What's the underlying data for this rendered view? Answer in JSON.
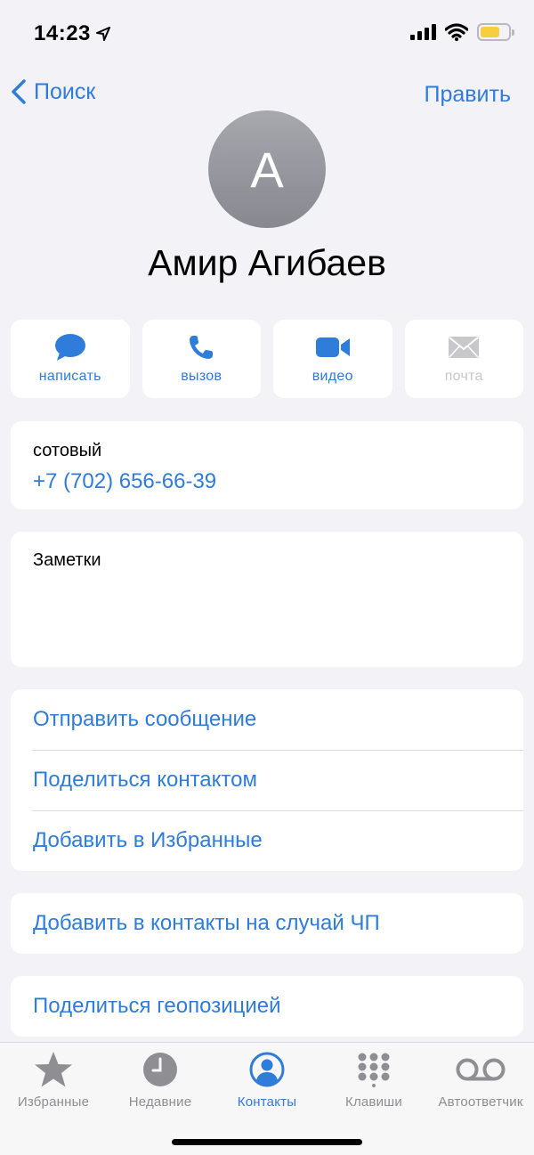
{
  "status": {
    "time": "14:23"
  },
  "nav": {
    "back_label": "Поиск",
    "edit_label": "Править"
  },
  "contact": {
    "initial": "А",
    "name": "Амир Агибаев"
  },
  "actions": [
    {
      "label": "написать",
      "icon": "message-bubble-icon",
      "enabled": true
    },
    {
      "label": "вызов",
      "icon": "phone-icon",
      "enabled": true
    },
    {
      "label": "видео",
      "icon": "video-camera-icon",
      "enabled": true
    },
    {
      "label": "почта",
      "icon": "envelope-icon",
      "enabled": false
    }
  ],
  "phone": {
    "label": "сотовый",
    "value": "+7 (702) 656-66-39"
  },
  "notes": {
    "label": "Заметки"
  },
  "list_actions": [
    "Отправить сообщение",
    "Поделиться контактом",
    "Добавить в Избранные"
  ],
  "emergency": {
    "label": "Добавить в контакты на случай ЧП"
  },
  "geo": {
    "label": "Поделиться геопозицией"
  },
  "tabbar": {
    "items": [
      {
        "label": "Избранные",
        "icon": "star-icon"
      },
      {
        "label": "Недавние",
        "icon": "clock-icon"
      },
      {
        "label": "Контакты",
        "icon": "contact-person-icon",
        "active": true
      },
      {
        "label": "Клавиши",
        "icon": "keypad-icon"
      },
      {
        "label": "Автоответчик",
        "icon": "voicemail-icon"
      }
    ]
  },
  "colors": {
    "accent": "#2f7cdb",
    "background": "#f2f2f7",
    "inactive": "#8e8e93",
    "battery": "#f7cf3e"
  }
}
